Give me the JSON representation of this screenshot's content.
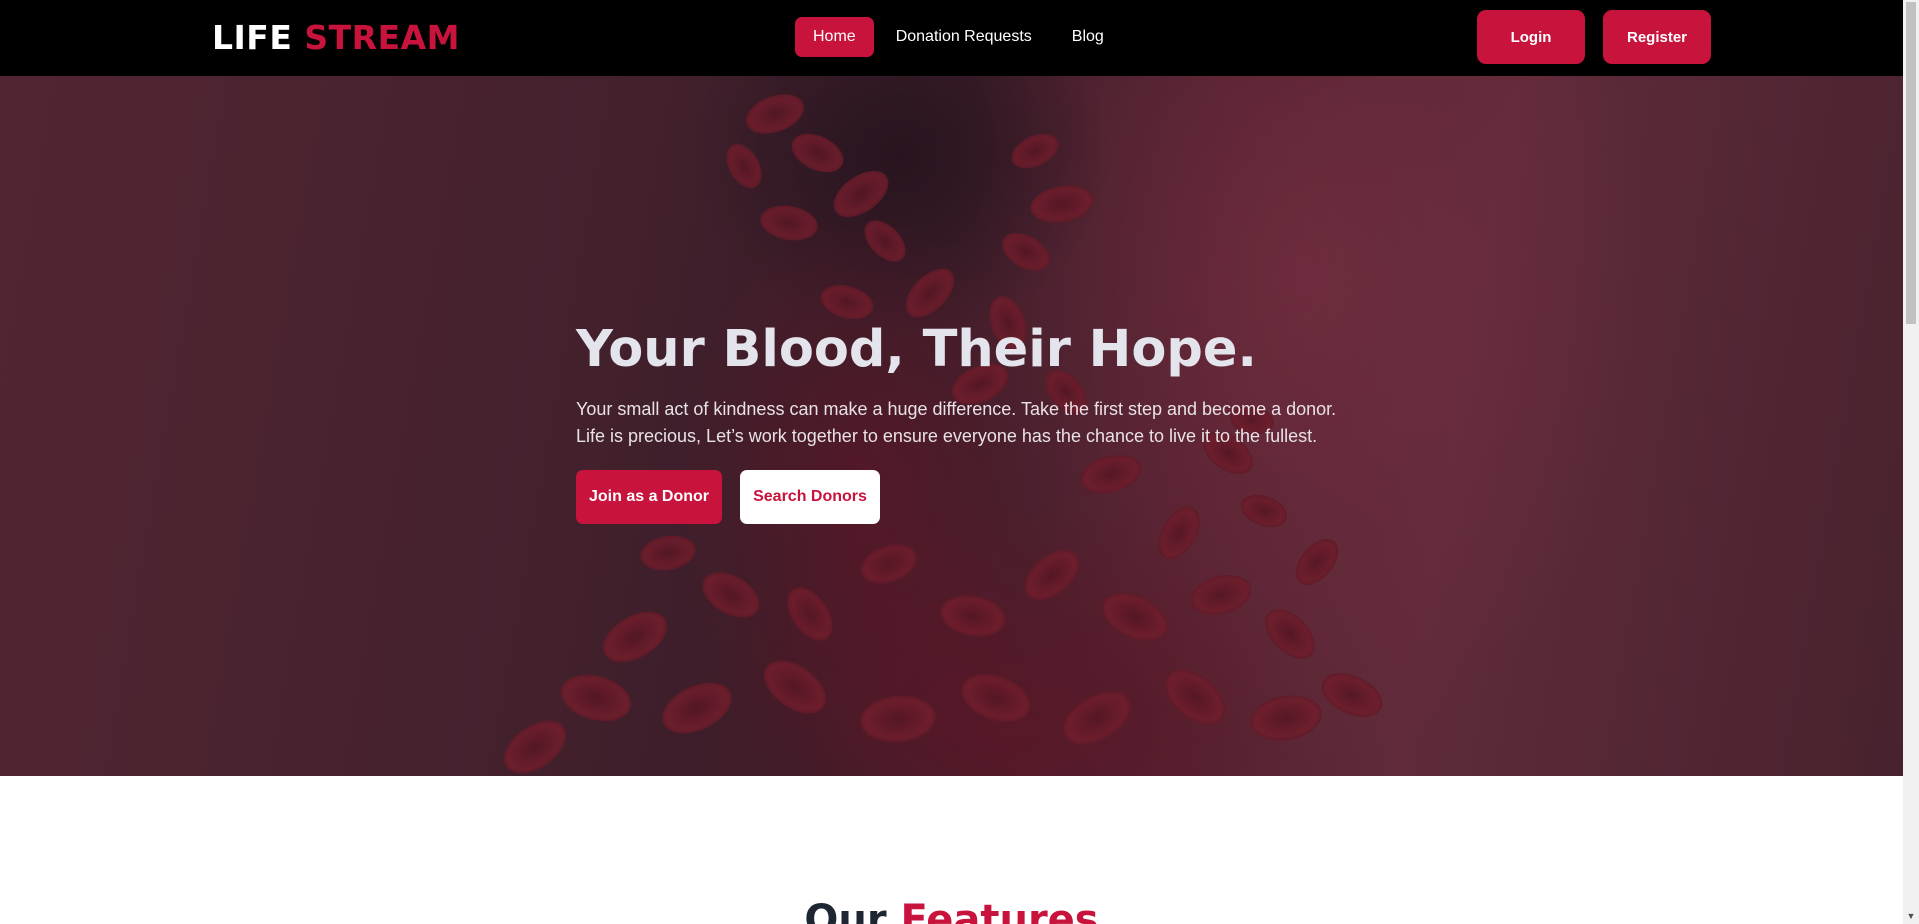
{
  "brand": {
    "part1": "LIFE",
    "part2": "STREAM",
    "accent_color": "#c8133c"
  },
  "nav": {
    "items": [
      {
        "label": "Home",
        "active": true
      },
      {
        "label": "Donation Requests",
        "active": false
      },
      {
        "label": "Blog",
        "active": false
      }
    ]
  },
  "auth": {
    "login_label": "Login",
    "register_label": "Register"
  },
  "hero": {
    "title": "Your Blood, Their Hope.",
    "subtitle_line1": "Your small act of kindness can make a huge difference. Take the first step and become a donor.",
    "subtitle_line2": "Life is precious, Let’s work together to ensure everyone has the chance to live it to the fullest.",
    "primary_cta": "Join as a Donor",
    "secondary_cta": "Search Donors",
    "background_image": "red-blood-cells"
  },
  "features": {
    "heading_part1": "Our",
    "heading_part2": "Features"
  },
  "icons": {
    "scroll_down": "chevron-down-icon"
  }
}
